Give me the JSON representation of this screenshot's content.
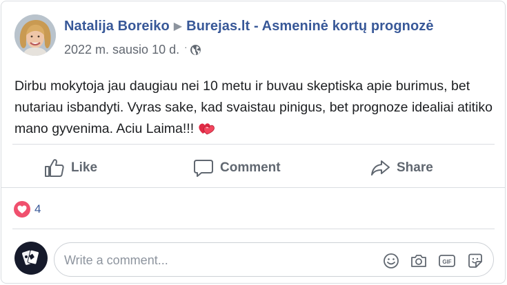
{
  "post": {
    "author": "Natalija Boreiko",
    "target": "Burejas.lt - Asmeninė kortų prognozė",
    "date": "2022 m. sausio 10 d.",
    "separator": "·",
    "text": "Dirbu mokytoja jau daugiau nei 10 metu ir buvau skeptiska apie burimus, bet nutariau isbandyti. Vyras sake, kad svaistau pinigus, bet prognoze idealiai atitiko mano gyvenima. Aciu Laima!!!",
    "emoji_icon": "sparkling-heart-icon"
  },
  "actions": {
    "like": "Like",
    "comment": "Comment",
    "share": "Share"
  },
  "reactions": {
    "icon": "heart-icon",
    "count": "4"
  },
  "composer": {
    "placeholder": "Write a comment...",
    "icons": [
      "emoji-icon",
      "camera-icon",
      "gif-icon",
      "sticker-icon"
    ]
  },
  "colors": {
    "link": "#385898",
    "muted": "#616770",
    "heart": "#f0506e",
    "border": "#dadde1"
  }
}
